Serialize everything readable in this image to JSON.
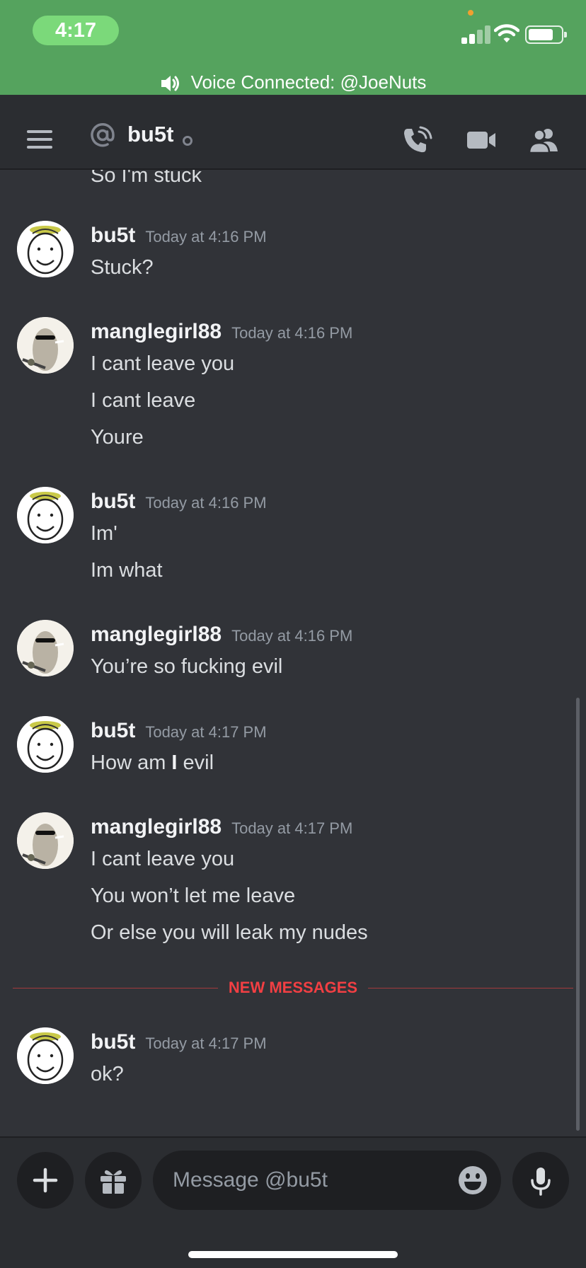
{
  "status_bar": {
    "time": "4:17",
    "voice_connected": "Voice Connected: @JoeNuts",
    "battery_level": 0.8
  },
  "header": {
    "channel_prefix": "@",
    "title": "bu5t"
  },
  "clipped_line": "So I'm stuck",
  "message_groups": [
    {
      "author": "bu5t",
      "timestamp": "Today at 4:16 PM",
      "lines": [
        "Stuck?"
      ]
    },
    {
      "author": "manglegirl88",
      "timestamp": "Today at 4:16 PM",
      "lines": [
        "I cant leave you",
        "I cant leave",
        "Youre"
      ]
    },
    {
      "author": "bu5t",
      "timestamp": "Today at 4:16 PM",
      "lines": [
        "Im'",
        "Im what"
      ]
    },
    {
      "author": "manglegirl88",
      "timestamp": "Today at 4:16 PM",
      "lines": [
        "You’re so fucking evil"
      ]
    },
    {
      "author": "bu5t",
      "timestamp": "Today at 4:17 PM",
      "lines": [
        "How am ",
        "I",
        " evil"
      ]
    },
    {
      "author": "manglegirl88",
      "timestamp": "Today at 4:17 PM",
      "lines": [
        "I cant leave you",
        "You won’t let me leave",
        "Or else you will leak my nudes"
      ]
    },
    {
      "author": "bu5t",
      "timestamp": "Today at 4:17 PM",
      "lines": [
        "ok?"
      ]
    }
  ],
  "new_messages_label": "NEW MESSAGES",
  "composer": {
    "placeholder": "Message @bu5t"
  },
  "colors": {
    "status_green": "#55a35e",
    "background": "#313338",
    "new_messages_red": "#f23f43"
  },
  "icons": [
    "speaker-icon",
    "hamburger-icon",
    "at-icon",
    "voice-call-icon",
    "video-call-icon",
    "members-icon",
    "plus-icon",
    "gift-icon",
    "emoji-icon",
    "microphone-icon"
  ]
}
